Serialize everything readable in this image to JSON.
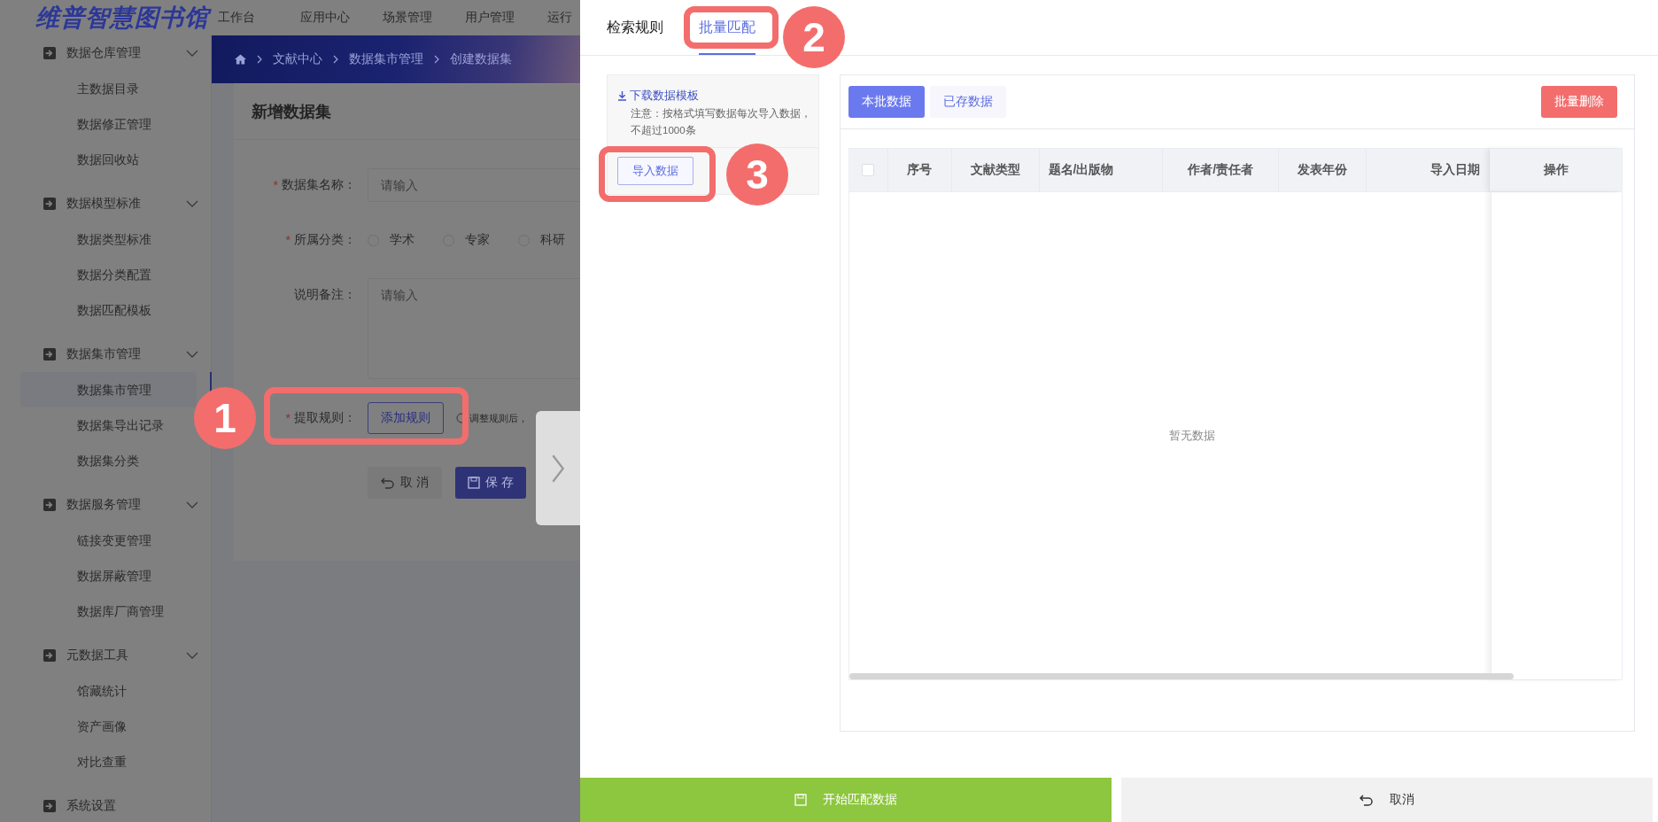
{
  "header": {
    "logo": "维普智慧图书馆",
    "nav": [
      {
        "label": "工作台"
      },
      {
        "label": "应用中心"
      },
      {
        "label": "场景管理"
      },
      {
        "label": "用户管理"
      },
      {
        "label": "运行"
      }
    ]
  },
  "sidebar": {
    "groups": [
      {
        "label": "数据仓库管理",
        "expanded": true,
        "children": [
          {
            "label": "主数据目录",
            "selected": false
          },
          {
            "label": "数据修正管理",
            "selected": false
          },
          {
            "label": "数据回收站",
            "selected": false
          }
        ]
      },
      {
        "label": "数据模型标准",
        "expanded": true,
        "children": [
          {
            "label": "数据类型标准",
            "selected": false
          },
          {
            "label": "数据分类配置",
            "selected": false
          },
          {
            "label": "数据匹配模板",
            "selected": false
          }
        ]
      },
      {
        "label": "数据集市管理",
        "expanded": true,
        "children": [
          {
            "label": "数据集市管理",
            "selected": true
          },
          {
            "label": "数据集导出记录",
            "selected": false
          },
          {
            "label": "数据集分类",
            "selected": false
          }
        ]
      },
      {
        "label": "数据服务管理",
        "expanded": true,
        "children": [
          {
            "label": "链接变更管理",
            "selected": false
          },
          {
            "label": "数据屏蔽管理",
            "selected": false
          },
          {
            "label": "数据库厂商管理",
            "selected": false
          }
        ]
      },
      {
        "label": "元数据工具",
        "expanded": true,
        "children": [
          {
            "label": "馆藏统计",
            "selected": false
          },
          {
            "label": "资产画像",
            "selected": false
          },
          {
            "label": "对比查重",
            "selected": false
          }
        ]
      },
      {
        "label": "系统设置"
      }
    ]
  },
  "breadcrumb": [
    "文献中心",
    "数据集市管理",
    "创建数据集"
  ],
  "form": {
    "title": "新增数据集",
    "required_mark": "*",
    "name": {
      "label": "数据集名称：",
      "required": true,
      "placeholder": "请输入"
    },
    "category": {
      "label": "所属分类：",
      "required": true,
      "options": [
        {
          "label": "学术",
          "selected": false
        },
        {
          "label": "专家",
          "selected": false
        },
        {
          "label": "科研",
          "selected": false
        }
      ]
    },
    "remark": {
      "label": "说明备注：",
      "required": false,
      "placeholder": "请输入"
    },
    "rule": {
      "label": "提取规则：",
      "required": true,
      "button": "添加规则",
      "hint": "调整规则后，"
    },
    "buttons": {
      "cancel": "取 消",
      "save": "保 存"
    }
  },
  "drawer": {
    "tabs": [
      {
        "label": "检索规则",
        "selected": false
      },
      {
        "label": "批量匹配",
        "selected": true
      }
    ],
    "import_panel": {
      "download_link": "下载数据模板",
      "note": [
        "注意：按格式填写数据每次导入数据，",
        "不超过1000条"
      ],
      "import_button": "导入数据"
    },
    "data_tabs": [
      {
        "label": "本批数据",
        "selected": true
      },
      {
        "label": "已存数据",
        "selected": false
      }
    ],
    "delete_button": "批量删除",
    "table": {
      "select_all_checked": false,
      "columns": [
        "序号",
        "文献类型",
        "题名/出版物",
        "作者/责任者",
        "发表年份",
        "导入日期",
        "操作"
      ],
      "empty_text": "暂无数据"
    },
    "footer": {
      "start": "开始匹配数据",
      "cancel": "取消"
    }
  },
  "annotations": [
    {
      "number": "1"
    },
    {
      "number": "2"
    },
    {
      "number": "3"
    }
  ]
}
